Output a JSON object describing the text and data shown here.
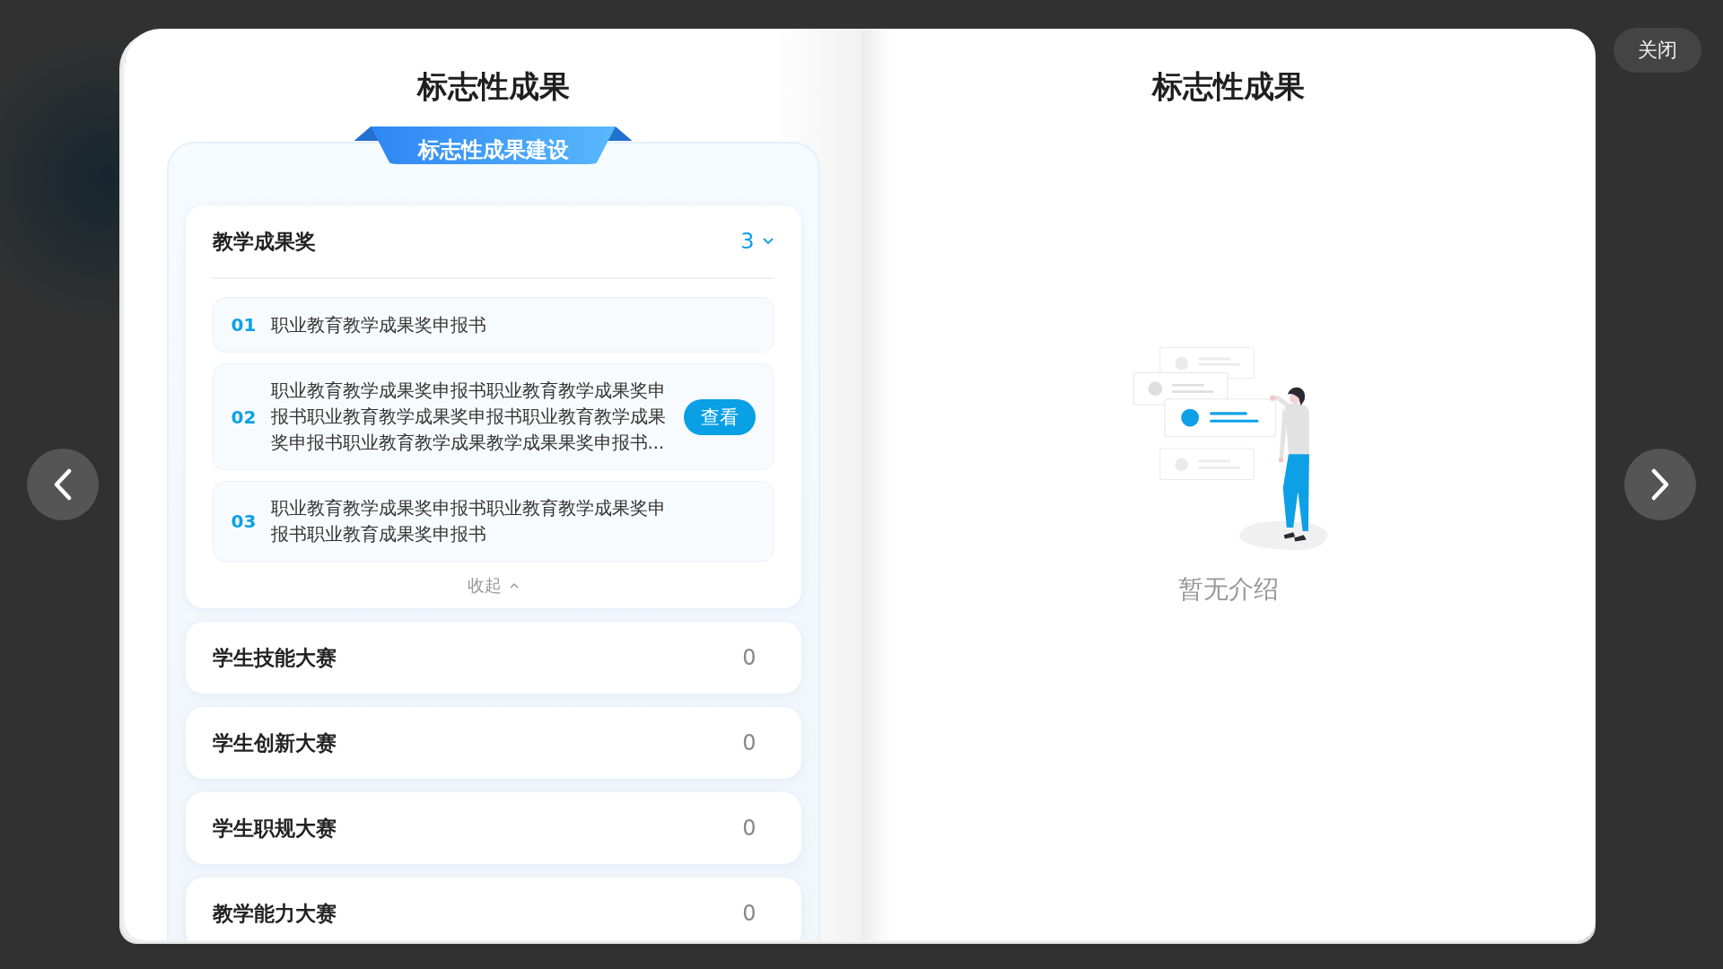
{
  "close_button": "关闭",
  "left_page": {
    "title": "标志性成果",
    "banner": "标志性成果建设",
    "categories": [
      {
        "name": "教学成果奖",
        "count": "3",
        "expanded": true,
        "collapse_label": "收起",
        "items": [
          {
            "number": "01",
            "text": "职业教育教学成果奖申报书"
          },
          {
            "number": "02",
            "text": "职业教育教学成果奖申报书职业教育教学成果奖申报书职业教育教学成果奖申报书职业教育教学成果奖申报书职业教育教学成果教学成果果奖申报书...",
            "action": "查看"
          },
          {
            "number": "03",
            "text": "职业教育教学成果奖申报书职业教育教学成果奖申报书职业教育成果奖申报书"
          }
        ]
      },
      {
        "name": "学生技能大赛",
        "count": "0",
        "expanded": false
      },
      {
        "name": "学生创新大赛",
        "count": "0",
        "expanded": false
      },
      {
        "name": "学生职规大赛",
        "count": "0",
        "expanded": false
      },
      {
        "name": "教学能力大赛",
        "count": "0",
        "expanded": false
      }
    ]
  },
  "right_page": {
    "title": "标志性成果",
    "empty_text": "暂无介绍"
  }
}
